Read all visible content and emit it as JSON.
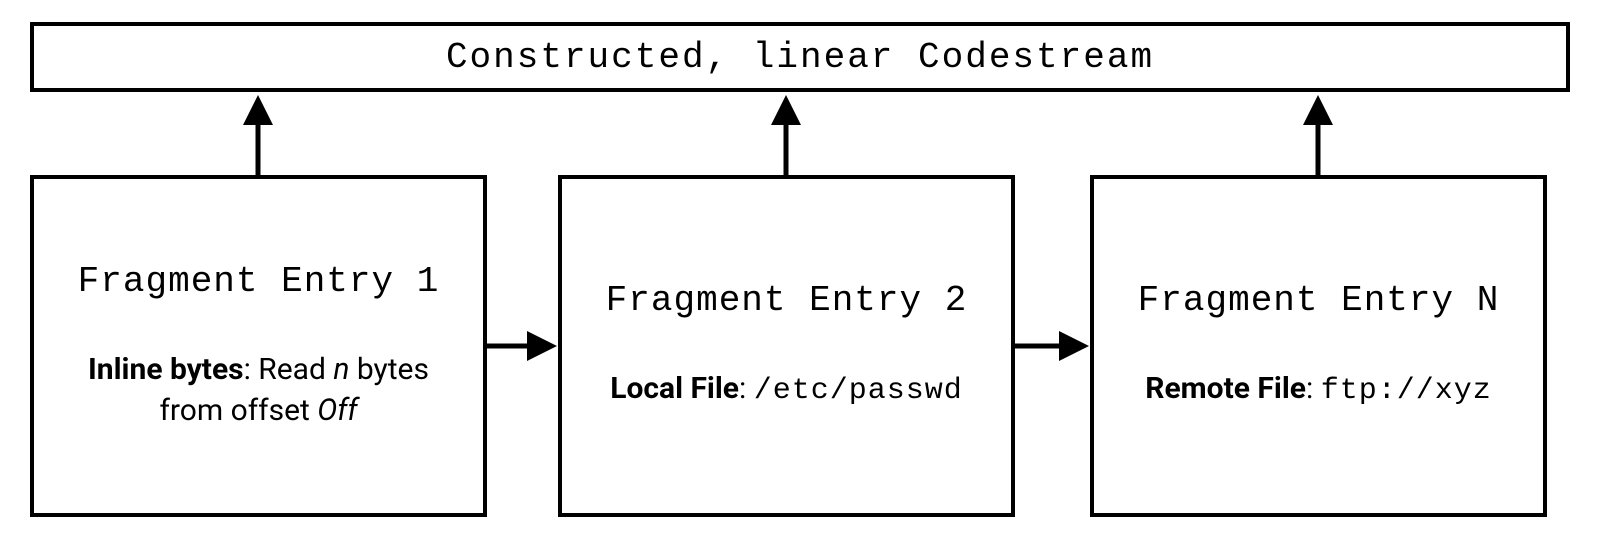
{
  "header": {
    "title": "Constructed, linear Codestream"
  },
  "fragments": [
    {
      "title": "Fragment Entry 1",
      "label": "Inline bytes",
      "desc_prefix": ": Read ",
      "var1": "n",
      "desc_mid": " bytes from offset ",
      "var2": "Off"
    },
    {
      "title": "Fragment Entry 2",
      "label": "Local File",
      "path": "/etc/passwd"
    },
    {
      "title": "Fragment Entry N",
      "label": "Remote File",
      "path": "ftp://xyz"
    }
  ]
}
